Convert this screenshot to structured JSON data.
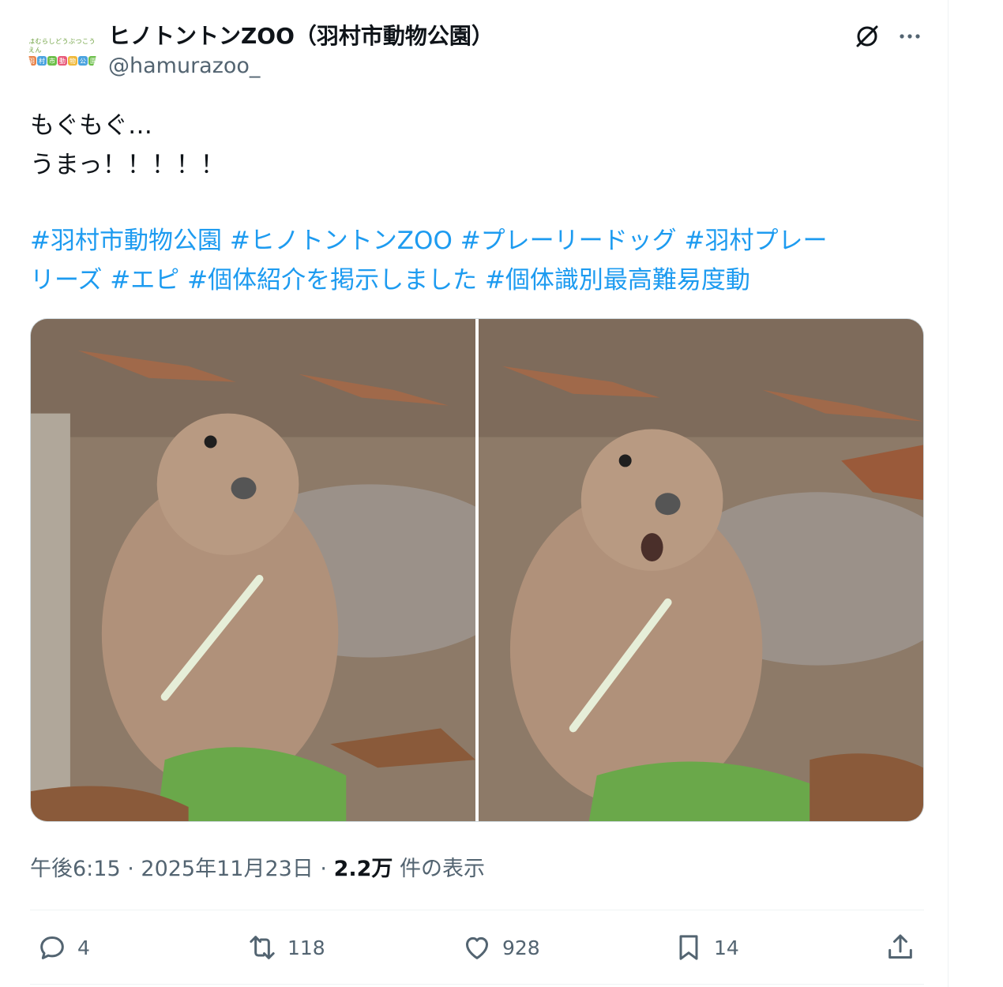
{
  "author": {
    "display_name": "ヒノトントンZOO（羽村市動物公園）",
    "handle": "@hamurazoo_",
    "avatar_logo_top": "はむらしどうぶつこうえん",
    "avatar_logo_chars": [
      "羽",
      "村",
      "市",
      "動",
      "物",
      "公",
      "園"
    ]
  },
  "tweet": {
    "lines": [
      "もぐもぐ…",
      "うまっ！！！！！"
    ],
    "hashtags_line1": "#羽村市動物公園 #ヒノトントンZOO #プレーリードッグ #羽村プレー",
    "hashtags_line2": "リーズ #エピ #個体紹介を掲示しました #個体識別最高難易度動"
  },
  "meta": {
    "time": "午後6:15",
    "sep1": " · ",
    "date": "2025年11月23日",
    "sep2": " · ",
    "views_num": "2.2万",
    "views_label": " 件の表示"
  },
  "actions": {
    "reply_count": "4",
    "retweet_count": "118",
    "like_count": "928",
    "bookmark_count": "14"
  },
  "colors": {
    "link": "#1d9bf0",
    "secondary_text": "#536471",
    "primary_text": "#0f1419",
    "border": "#cfd9de"
  },
  "icons": [
    "grok-icon",
    "more-icon",
    "reply-icon",
    "retweet-icon",
    "like-icon",
    "bookmark-icon",
    "share-icon"
  ]
}
